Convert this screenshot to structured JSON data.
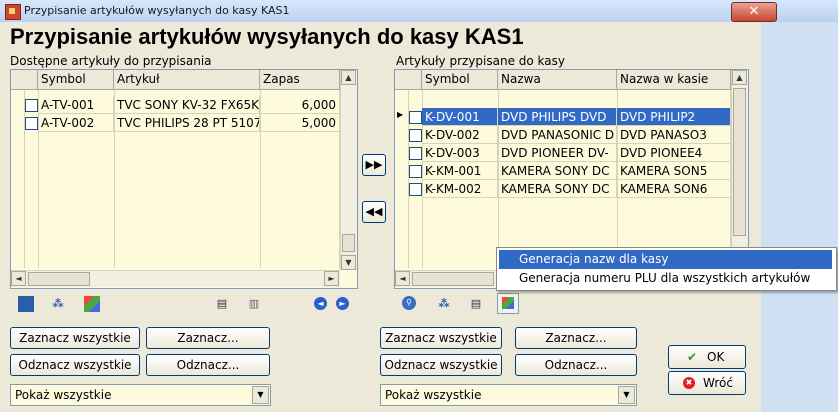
{
  "window": {
    "title": "Przypisanie artykułów wysyłanych do kasy KAS1",
    "close_glyph": "✕"
  },
  "heading": "Przypisanie artykułów wysyłanych do kasy KAS1",
  "left": {
    "label": "Dostępne artykuły do przypisania",
    "columns": [
      "Symbol",
      "Artykuł",
      "Zapas"
    ],
    "rows": [
      {
        "symbol": "A-TV-001",
        "artykul": "TVC SONY KV-32 FX65K",
        "zapas": "6,000"
      },
      {
        "symbol": "A-TV-002",
        "artykul": "TVC PHILIPS 28 PT 5107",
        "zapas": "5,000"
      }
    ],
    "select_all": "Zaznacz wszystkie",
    "select": "Zaznacz...",
    "deselect_all": "Odznacz wszystkie",
    "deselect": "Odznacz...",
    "filter": "Pokaż wszystkie"
  },
  "right": {
    "label": "Artykuły przypisane do kasy",
    "columns": [
      "Symbol",
      "Nazwa",
      "Nazwa w kasie"
    ],
    "rows": [
      {
        "symbol": "K-DV-001",
        "nazwa": "DVD  PHILIPS DVD",
        "nazwa_kasa": "DVD PHILIP2"
      },
      {
        "symbol": "K-DV-002",
        "nazwa": "DVD PANASONIC D",
        "nazwa_kasa": "DVD PANASO3"
      },
      {
        "symbol": "K-DV-003",
        "nazwa": "DVD PIONEER DV-",
        "nazwa_kasa": "DVD PIONEE4"
      },
      {
        "symbol": "K-KM-001",
        "nazwa": "KAMERA SONY DC",
        "nazwa_kasa": "KAMERA SON5"
      },
      {
        "symbol": "K-KM-002",
        "nazwa": "KAMERA SONY DC",
        "nazwa_kasa": "KAMERA SON6"
      }
    ],
    "select_all": "Zaznacz wszystkie",
    "select": "Zaznacz...",
    "deselect_all": "Odznacz wszystkie",
    "deselect": "Odznacz...",
    "filter": "Pokaż wszystkie"
  },
  "transfer": {
    "add_glyph": "▶▶",
    "remove_glyph": "◀◀"
  },
  "context_menu": {
    "items": [
      "Generacja nazw dla kasy",
      "Generacja numeru PLU dla wszystkich artykułów"
    ]
  },
  "ok_label": "OK",
  "back_label": "Wróć",
  "icons": {
    "arrow_left": "◄",
    "arrow_right": "►",
    "arrow_up": "▲",
    "arrow_down": "▼",
    "check": "✔",
    "cross": "✖",
    "row_pointer": "▶"
  },
  "colors": {
    "grid_bg": "#fdfbdc",
    "selection": "#316ac5",
    "window_bg": "#ece9d8"
  }
}
